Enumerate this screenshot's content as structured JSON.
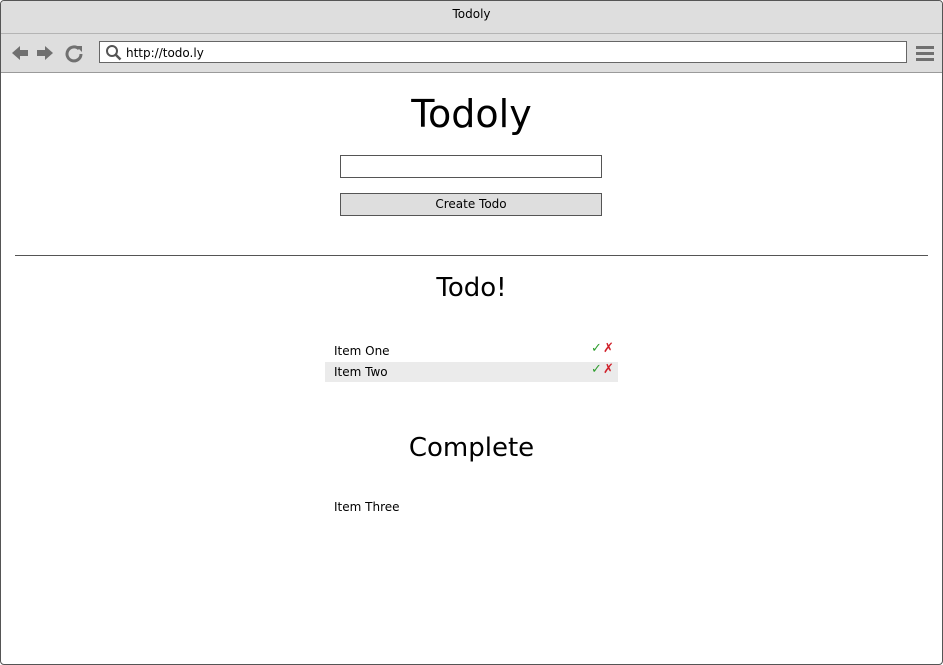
{
  "window": {
    "title": "Todoly"
  },
  "toolbar": {
    "back_icon": "arrow-left-icon",
    "forward_icon": "arrow-right-icon",
    "reload_icon": "reload-icon",
    "url": "http://todo.ly",
    "search_icon": "search-icon",
    "menu_icon": "hamburger-menu-icon"
  },
  "app": {
    "title": "Todoly",
    "input_value": "",
    "create_button_label": "Create Todo"
  },
  "todo_section": {
    "heading": "Todo!",
    "items": [
      {
        "label": "Item One",
        "check": "✓",
        "cross": "✗",
        "highlighted": false
      },
      {
        "label": "Item Two",
        "check": "✓",
        "cross": "✗",
        "highlighted": true
      }
    ]
  },
  "complete_section": {
    "heading": "Complete",
    "items": [
      {
        "label": "Item Three"
      }
    ]
  },
  "colors": {
    "chrome": "#dedede",
    "check": "#2e9e2e",
    "cross": "#d0202a",
    "highlight_row": "#ebebeb"
  }
}
